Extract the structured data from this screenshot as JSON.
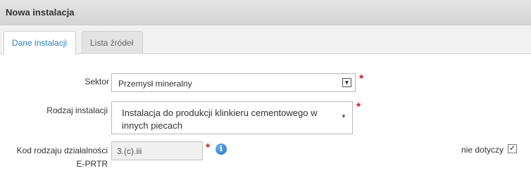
{
  "window": {
    "title": "Nowa instalacja"
  },
  "tabs": [
    {
      "label": "Dane instalacji",
      "active": true
    },
    {
      "label": "Lista źródeł",
      "active": false
    }
  ],
  "form": {
    "sektor": {
      "label": "Sektor",
      "value": "Przemysł mineralny",
      "required": true
    },
    "rodzaj": {
      "label": "Rodzaj instalacji",
      "value_line1": "Instalacja do produkcji klinkieru cementowego w",
      "value_line2": "innych piecach",
      "required": true
    },
    "kod": {
      "label_line1": "Kod rodzaju działalności",
      "label_line2": "E-PRTR",
      "value": "3.(c).iii",
      "required": true,
      "info_icon": "info-icon"
    },
    "nie_dotyczy": {
      "label": "nie dotyczy",
      "checked": true,
      "check_glyph": "✓"
    }
  },
  "colors": {
    "accent": "#2a82c1",
    "required": "#cc2020",
    "info": "#2b7bd4"
  }
}
